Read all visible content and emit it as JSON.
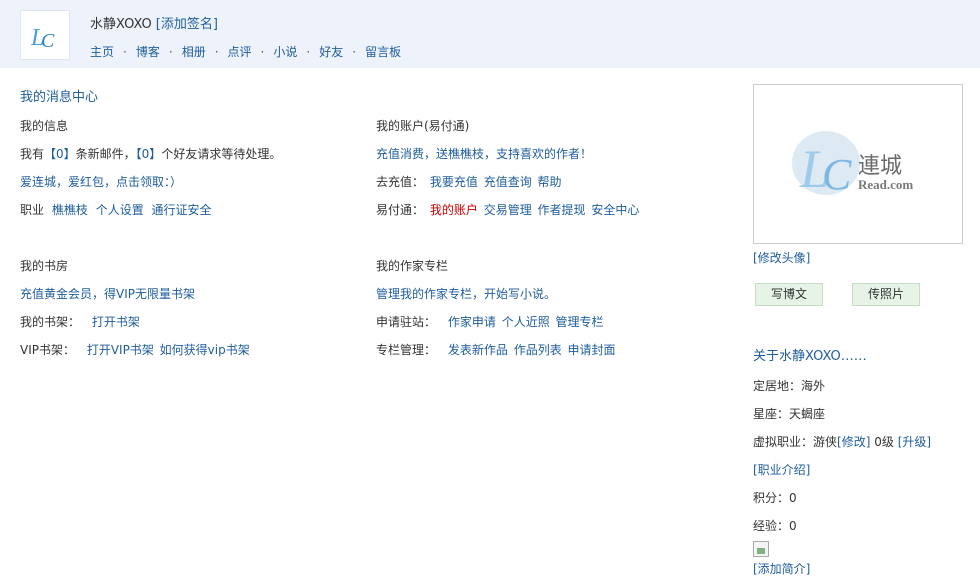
{
  "header": {
    "username": "水静XOXO",
    "add_signature": "[添加签名]",
    "nav": [
      "主页",
      "博客",
      "相册",
      "点评",
      "小说",
      "好友",
      "留言板"
    ],
    "nav_separator": "·"
  },
  "main": {
    "title": "我的消息中心",
    "info": {
      "heading": "我的信息",
      "line1_pre": "我有",
      "mail_count": "【0】",
      "line1_mid": "条新邮件，",
      "friend_count": "【0】",
      "line1_post": "个好友请求等待处理。",
      "promo": "爱连城，爱红包，点击领取：）",
      "job_label": "职业",
      "job_links": [
        "樵樵枝",
        "个人设置",
        "通行证安全"
      ]
    },
    "account": {
      "heading": "我的账户(易付通)",
      "promo": "充值消费，送樵樵枝，支持喜欢的作者！",
      "recharge_label": "去充值：",
      "recharge_links": [
        "我要充值",
        "充值查询",
        "帮助"
      ],
      "yft_label": "易付通：",
      "my_account": "我的账户",
      "yft_links": [
        "交易管理",
        "作者提现",
        "安全中心"
      ]
    },
    "study": {
      "heading": "我的书房",
      "promo": "充值黄金会员，得VIP无限量书架",
      "shelf_label": "我的书架：",
      "shelf_link": "打开书架",
      "vip_label": "VIP书架：",
      "vip_links": [
        "打开VIP书架",
        "如何获得vip书架"
      ]
    },
    "author": {
      "heading": "我的作家专栏",
      "promo": "管理我的作家专栏，开始写小说。",
      "apply_label": "申请驻站：",
      "apply_links": [
        "作家申请",
        "个人近照",
        "管理专栏"
      ],
      "manage_label": "专栏管理：",
      "manage_links": [
        "发表新作品",
        "作品列表",
        "申请封面"
      ]
    }
  },
  "sidebar": {
    "avatar_logo_text": "連城",
    "avatar_logo_sub": "Read.com",
    "edit_avatar": "[修改头像]",
    "write_blog": "写博文",
    "upload_photo": "传照片",
    "about_title": "关于水静XOXO……",
    "location_label": "定居地：",
    "location_value": "海外",
    "zodiac_label": "星座：",
    "zodiac_value": "天蝎座",
    "job_label": "虚拟职业：",
    "job_value": "游侠",
    "job_edit": "[修改]",
    "job_level": "0级",
    "job_upgrade": "[升级]",
    "job_intro": "[职业介绍]",
    "points_label": "积分：",
    "points_value": "0",
    "exp_label": "经验：",
    "exp_value": "0",
    "add_intro": "[添加简介]"
  },
  "colors": {
    "link": "#1f5d9c",
    "header_bg": "#eef3fb",
    "highlight": "#cc0000",
    "button_bg": "#e6f3e6"
  }
}
